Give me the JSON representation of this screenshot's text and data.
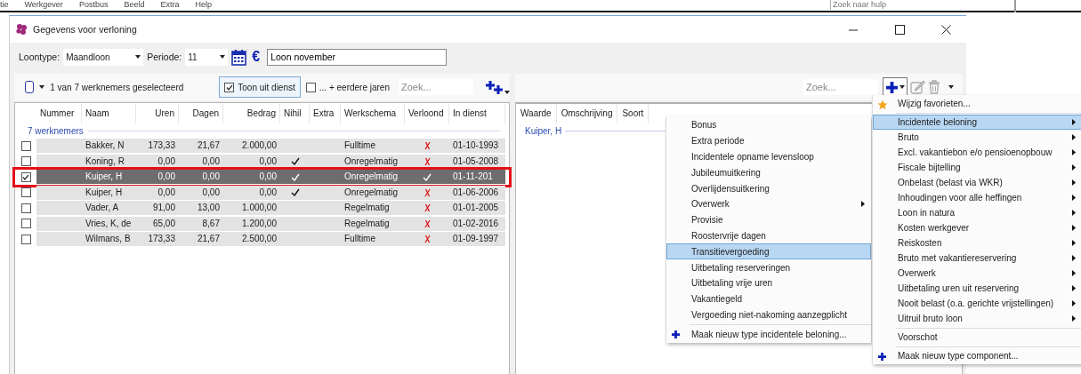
{
  "menubar": {
    "items": [
      "tie",
      "Werkgever",
      "Postbus",
      "Beeld",
      "Extra",
      "Help"
    ],
    "help_search": {
      "placeholder": "Zoek naar hulp"
    }
  },
  "window": {
    "title": "Gegevens voor verloning"
  },
  "toolbar": {
    "loontype": {
      "label": "Loontype:",
      "value": "Maandloon"
    },
    "periode": {
      "label": "Periode:",
      "value": "11"
    },
    "currency_symbol": "€",
    "description": {
      "value": "Loon november"
    }
  },
  "selection_bar": {
    "select_all": {
      "checked": false
    },
    "summary": "1 van 7 werknemers geselecteerd",
    "show_inactive": {
      "label": "Toon uit dienst",
      "checked": true
    },
    "earlier_years": {
      "label": "... + eerdere jaren",
      "checked": false
    },
    "search": {
      "placeholder": "Zoek..."
    }
  },
  "employees": {
    "columns": [
      "Nummer",
      "Naam",
      "Uren",
      "Dagen",
      "Bedrag",
      "Nihil",
      "Extra",
      "Werkschema",
      "Verloond",
      "In dienst"
    ],
    "group": "7 werknemers",
    "rows": [
      {
        "checked": false,
        "selected": false,
        "highlighted": false,
        "naam": "Bakker, N",
        "uren": "173,33",
        "dagen": "21,67",
        "bedrag": "2.000,00",
        "nihil": false,
        "werkschema": "Fulltime",
        "verloond": false,
        "in_dienst": "01-10-1993"
      },
      {
        "checked": false,
        "selected": false,
        "highlighted": false,
        "naam": "Koning, R",
        "uren": "0,00",
        "dagen": "0,00",
        "bedrag": "0,00",
        "nihil": true,
        "werkschema": "Onregelmatig",
        "verloond": false,
        "in_dienst": "01-05-2008"
      },
      {
        "checked": true,
        "selected": true,
        "highlighted": true,
        "naam": "Kuiper, H",
        "uren": "0,00",
        "dagen": "0,00",
        "bedrag": "0,00",
        "nihil": true,
        "werkschema": "Onregelmatig",
        "verloond": true,
        "in_dienst": "01-11-201"
      },
      {
        "checked": false,
        "selected": false,
        "highlighted": false,
        "naam": "Kuiper, H",
        "uren": "0,00",
        "dagen": "0,00",
        "bedrag": "0,00",
        "nihil": true,
        "werkschema": "Onregelmatig",
        "verloond": false,
        "in_dienst": "01-06-2006"
      },
      {
        "checked": false,
        "selected": false,
        "highlighted": false,
        "naam": "Vader, A",
        "uren": "91,00",
        "dagen": "13,00",
        "bedrag": "1.000,00",
        "nihil": false,
        "werkschema": "Regelmatig",
        "verloond": false,
        "in_dienst": "01-01-2005"
      },
      {
        "checked": false,
        "selected": false,
        "highlighted": false,
        "naam": "Vries, K, de",
        "uren": "65,00",
        "dagen": "8,67",
        "bedrag": "1.200,00",
        "nihil": false,
        "werkschema": "Regelmatig",
        "verloond": false,
        "in_dienst": "01-02-2016"
      },
      {
        "checked": false,
        "selected": false,
        "highlighted": false,
        "naam": "Wilmans, B",
        "uren": "173,33",
        "dagen": "21,67",
        "bedrag": "2.500,00",
        "nihil": false,
        "werkschema": "Fulltime",
        "verloond": false,
        "in_dienst": "01-09-1997"
      }
    ]
  },
  "components": {
    "search": {
      "placeholder": "Zoek..."
    },
    "columns": [
      "Waarde",
      "Omschrijving",
      "Soort"
    ],
    "group": "Kuiper, H"
  },
  "submenu": {
    "items": [
      {
        "kind": "item",
        "label": "Bonus",
        "selected": false
      },
      {
        "kind": "item",
        "label": "Extra periode",
        "selected": false
      },
      {
        "kind": "item",
        "label": "Incidentele opname levensloop",
        "selected": false
      },
      {
        "kind": "item",
        "label": "Jubileumuitkering",
        "selected": false
      },
      {
        "kind": "item",
        "label": "Overlijdensuitkering",
        "selected": false
      },
      {
        "kind": "submenu",
        "label": "Overwerk",
        "selected": false
      },
      {
        "kind": "item",
        "label": "Provisie",
        "selected": false
      },
      {
        "kind": "item",
        "label": "Roostervrije dagen",
        "selected": false
      },
      {
        "kind": "item",
        "label": "Transitievergoeding",
        "selected": true
      },
      {
        "kind": "item",
        "label": "Uitbetaling reserveringen",
        "selected": false
      },
      {
        "kind": "item",
        "label": "Uitbetaling vrije uren",
        "selected": false
      },
      {
        "kind": "item",
        "label": "Vakantiegeld",
        "selected": false
      },
      {
        "kind": "item",
        "label": "Vergoeding niet-nakoming aanzegplicht",
        "selected": false
      },
      {
        "kind": "separator"
      },
      {
        "kind": "new",
        "label": "Maak nieuw type incidentele beloning...",
        "selected": false
      }
    ]
  },
  "add_menu": {
    "items": [
      {
        "kind": "favorite",
        "label": "Wijzig favorieten...",
        "selected": false
      },
      {
        "kind": "separator"
      },
      {
        "kind": "submenu",
        "label": "Incidentele beloning",
        "selected": true
      },
      {
        "kind": "submenu",
        "label": "Bruto",
        "selected": false
      },
      {
        "kind": "submenu",
        "label": "Excl. vakantiebon e/o pensioenopbouw",
        "selected": false
      },
      {
        "kind": "submenu",
        "label": "Fiscale bijtelling",
        "selected": false
      },
      {
        "kind": "submenu",
        "label": "Onbelast (belast via WKR)",
        "selected": false
      },
      {
        "kind": "submenu",
        "label": "Inhoudingen voor alle heffingen",
        "selected": false
      },
      {
        "kind": "submenu",
        "label": "Loon in natura",
        "selected": false
      },
      {
        "kind": "submenu",
        "label": "Kosten werkgever",
        "selected": false
      },
      {
        "kind": "submenu",
        "label": "Reiskosten",
        "selected": false
      },
      {
        "kind": "submenu",
        "label": "Bruto met vakantiereservering",
        "selected": false
      },
      {
        "kind": "submenu",
        "label": "Overwerk",
        "selected": false
      },
      {
        "kind": "submenu",
        "label": "Uitbetaling uren uit reservering",
        "selected": false
      },
      {
        "kind": "submenu",
        "label": "Nooit belast (o.a. gerichte vrijstellingen)",
        "selected": false
      },
      {
        "kind": "submenu",
        "label": "Uitruil bruto loon",
        "selected": false
      },
      {
        "kind": "separator"
      },
      {
        "kind": "item",
        "label": "Voorschot",
        "selected": false
      },
      {
        "kind": "separator"
      },
      {
        "kind": "new",
        "label": "Maak nieuw type component...",
        "selected": false
      }
    ]
  }
}
